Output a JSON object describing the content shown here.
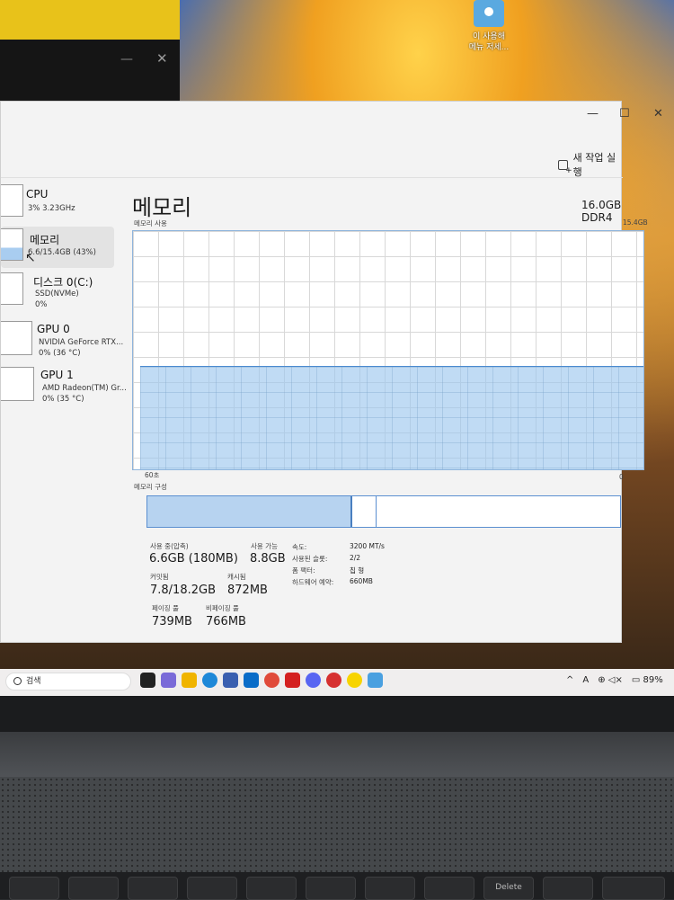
{
  "desktop": {
    "icon_label_line1": "이 사용해",
    "icon_label_line2": "메뉴 저세..."
  },
  "window": {
    "minimize": "—",
    "maximize": "☐",
    "close": "✕"
  },
  "command_bar": {
    "new_task": "새 작업 실행",
    "more": "···"
  },
  "nav": [
    {
      "title": "CPU",
      "sub": "3% 3.23GHz"
    },
    {
      "title": "메모리",
      "sub": "6.6/15.4GB (43%)"
    },
    {
      "title": "디스크 0(C:)",
      "sub": "SSD(NVMe)",
      "sub2": "0%"
    },
    {
      "title": "GPU 0",
      "sub": "NVIDIA GeForce RTX...",
      "sub2": "0% (36 °C)"
    },
    {
      "title": "GPU 1",
      "sub": "AMD Radeon(TM) Gr...",
      "sub2": "0% (35 °C)"
    }
  ],
  "main": {
    "title": "메모리",
    "spec": "16.0GB DDR4",
    "usage_label": "메모리 사용",
    "usage_max": "15.4GB",
    "time_left": "60초",
    "time_right": "0",
    "usage_fraction": 0.43,
    "composition_label": "메모리 구성"
  },
  "stats": {
    "in_use_label": "사용 중(압축)",
    "in_use_value": "6.6GB (180MB)",
    "available_label": "사용 가능",
    "available_value": "8.8GB",
    "committed_label": "커밋됨",
    "committed_value": "7.8/18.2GB",
    "cached_label": "캐시됨",
    "cached_value": "872MB",
    "paged_label": "페이징 풀",
    "paged_value": "739MB",
    "nonpaged_label": "비페이징 풀",
    "nonpaged_value": "766MB"
  },
  "specs": {
    "speed_label": "속도:",
    "speed_value": "3200 MT/s",
    "slots_label": "사용된 슬롯:",
    "slots_value": "2/2",
    "form_label": "폼 팩터:",
    "form_value": "칩 형",
    "reserved_label": "하드웨어 예약:",
    "reserved_value": "660MB"
  },
  "taskbar": {
    "search_placeholder": "검색",
    "tray_chevron": "^",
    "tray_ime": "A",
    "battery": "89%"
  },
  "keyboard": {
    "delete": "Delete"
  }
}
